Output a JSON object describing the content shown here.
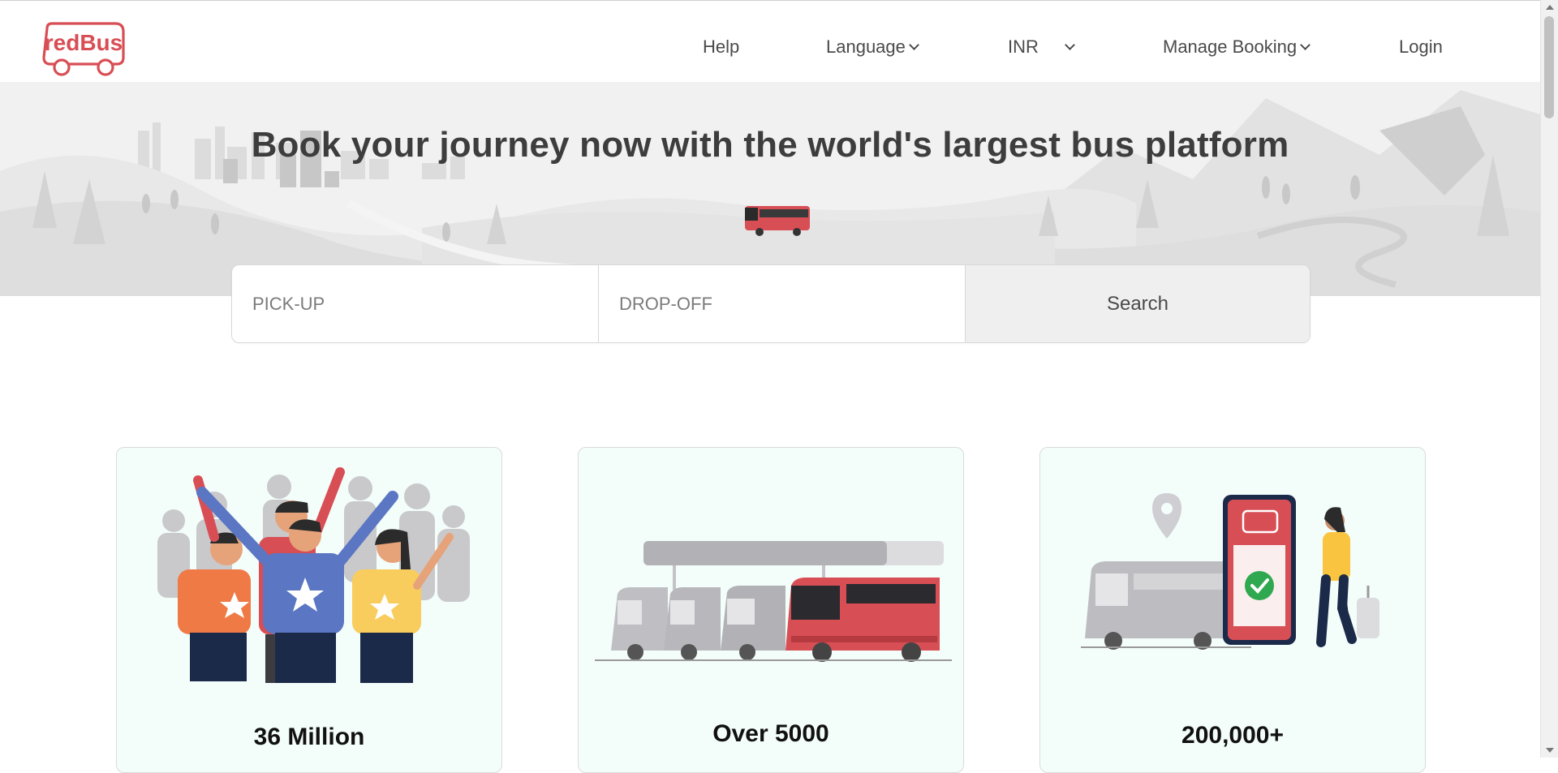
{
  "header": {
    "logo_text": "redBus",
    "nav": {
      "help": "Help",
      "language": "Language",
      "currency": "INR",
      "manage_booking": "Manage Booking",
      "login": "Login"
    }
  },
  "hero": {
    "headline": "Book your journey now with the world's largest bus platform"
  },
  "search": {
    "pickup_placeholder": "PICK-UP",
    "dropoff_placeholder": "DROP-OFF",
    "button_label": "Search"
  },
  "cards": [
    {
      "title": "36 Million",
      "illustration": "happy-customers-illustration"
    },
    {
      "title": "Over 5000",
      "illustration": "bus-fleet-illustration"
    },
    {
      "title": "200,000+",
      "illustration": "mobile-booking-illustration"
    }
  ],
  "colors": {
    "brand": "#d84e55",
    "hero_bg": "#f1f1f1",
    "card_bg": "#f3fdfa",
    "search_button_bg": "#efefef"
  }
}
